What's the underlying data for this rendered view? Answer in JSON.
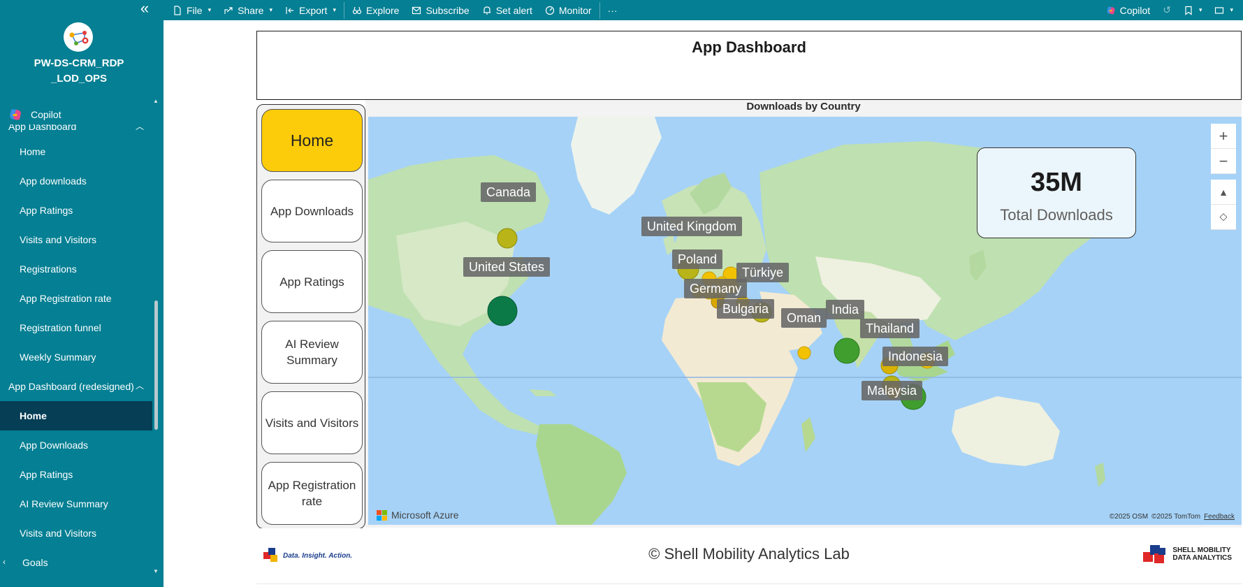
{
  "workspace": {
    "name": "PW-DS-CRM_RDP_LOD_OPS",
    "copilot_label": "Copilot"
  },
  "nav": {
    "section1": {
      "title": "App Dashboard",
      "items": [
        "Home",
        "App downloads",
        "App Ratings",
        "Visits and Visitors",
        "Registrations",
        "App Registration rate",
        "Registration funnel",
        "Weekly Summary"
      ]
    },
    "section2": {
      "title": "App Dashboard (redesigned)",
      "items": [
        "Home",
        "App Downloads",
        "App Ratings",
        "AI Review Summary",
        "Visits and Visitors"
      ],
      "active_item": "Home"
    },
    "section3": {
      "title": "Goals"
    }
  },
  "toolbar": {
    "file": "File",
    "share": "Share",
    "export": "Export",
    "explore": "Explore",
    "subscribe": "Subscribe",
    "set_alert": "Set alert",
    "monitor": "Monitor",
    "more": "···",
    "copilot": "Copilot"
  },
  "report": {
    "title": "App Dashboard",
    "page_buttons": [
      "Home",
      "App Downloads",
      "App Ratings",
      "AI Review Summary",
      "Visits and Visitors",
      "App Registration rate"
    ],
    "active_page": "Home",
    "map": {
      "title": "Downloads by Country",
      "countries": [
        "Canada",
        "United Kingdom",
        "Poland",
        "United States",
        "Türkiye",
        "Germany",
        "Bulgaria",
        "Oman",
        "India",
        "Thailand",
        "Indonesia",
        "Malaysia"
      ],
      "attribution": "Microsoft Azure",
      "credits": [
        "©2025 OSM",
        "©2025 TomTom"
      ],
      "feedback": "Feedback",
      "bubble_colors": {
        "low": "#f2c200",
        "mid": "#b9b518",
        "high_green": "#3f9e2e",
        "top": "#0b7a47"
      }
    },
    "kpi": {
      "value": "35M",
      "label": "Total Downloads"
    },
    "footer": {
      "copyright": "© Shell Mobility Analytics Lab",
      "left_logo_tag": "Data. Insight. Action.",
      "right_logo_line1": "SHELL MOBILITY",
      "right_logo_line2": "DATA ANALYTICS"
    }
  },
  "theme": {
    "teal": "#047f93",
    "nav_active": "#063e56",
    "accent_yellow": "#fccc0a"
  }
}
